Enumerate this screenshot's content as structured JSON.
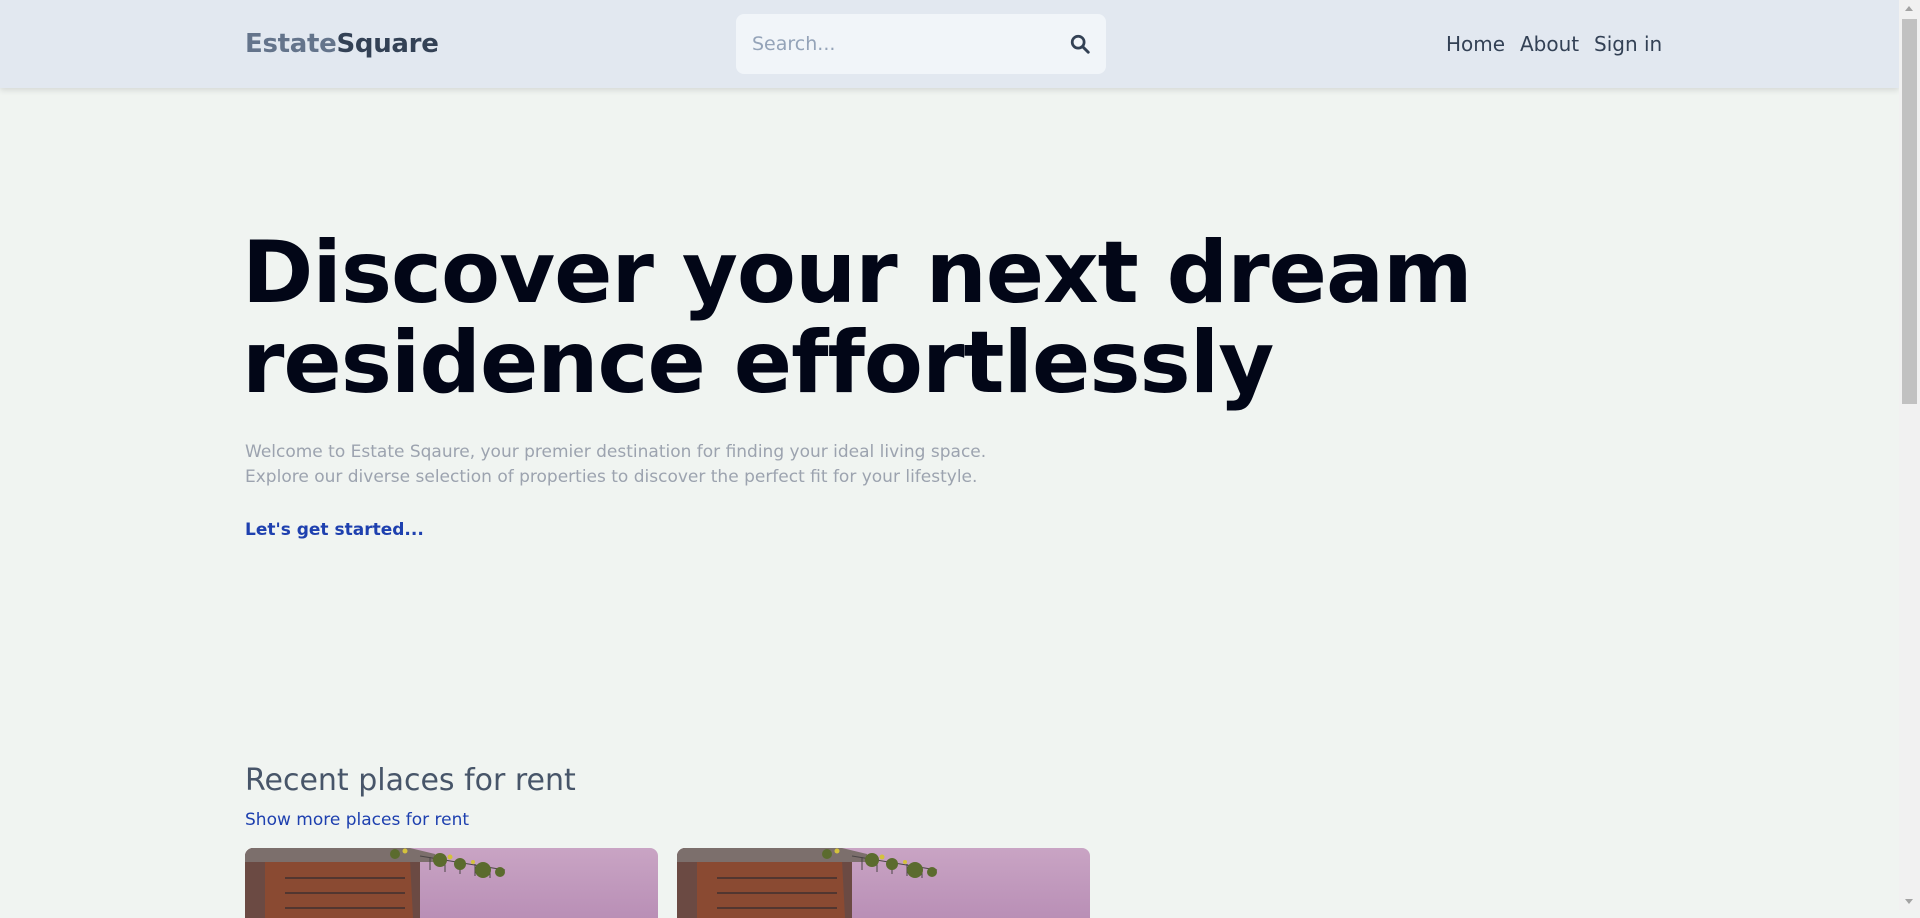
{
  "header": {
    "logo_part1": "Estate",
    "logo_part2": "Square",
    "search": {
      "placeholder": "Search...",
      "value": "",
      "icon": "search-icon"
    },
    "nav": [
      {
        "label": "Home"
      },
      {
        "label": "About"
      },
      {
        "label": "Sign in"
      }
    ]
  },
  "hero": {
    "title_line1": "Discover your next dream",
    "title_line2": "residence effortlessly",
    "description_line1": "Welcome to Estate Sqaure, your premier destination for finding your ideal living space.",
    "description_line2": "Explore our diverse selection of properties to discover the perfect fit for your lifestyle.",
    "cta": "Let's get started..."
  },
  "recent": {
    "title": "Recent places for rent",
    "more_link": "Show more places for rent",
    "listings": [
      {
        "image": "building-photo"
      },
      {
        "image": "building-photo"
      }
    ]
  },
  "colors": {
    "page_bg": "#f0f4f1",
    "header_bg": "#e2e8f0",
    "link": "#1e40af",
    "muted_text": "#9ca3af"
  }
}
